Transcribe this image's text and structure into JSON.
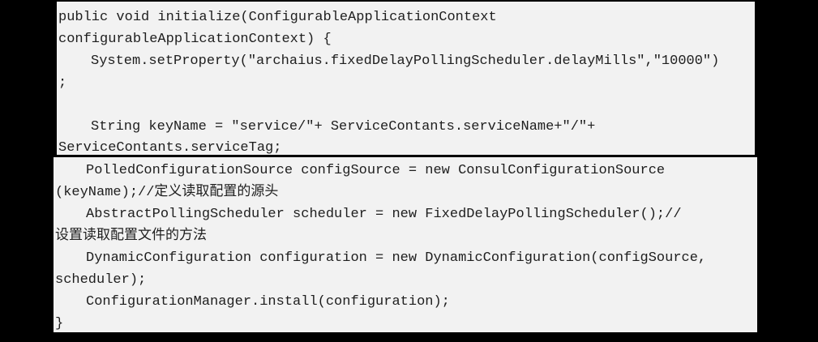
{
  "code": {
    "top_lines": [
      "public void initialize(ConfigurableApplicationContext",
      "configurableApplicationContext) {",
      "System.setProperty(\"archaius.fixedDelayPollingScheduler.delayMills\",\"10000\")",
      ";",
      "String keyName = \"service/\"+ ServiceContants.serviceName+\"/\"+",
      "ServiceContants.serviceTag;"
    ],
    "bottom_lines": [
      "PolledConfigurationSource configSource = new ConsulConfigurationSource",
      "(keyName);//定义读取配置的源头",
      "AbstractPollingScheduler scheduler = new FixedDelayPollingScheduler();//",
      "设置读取配置文件的方法",
      "DynamicConfiguration configuration = new DynamicConfiguration(configSource,",
      "scheduler);",
      "ConfigurationManager.install(configuration);",
      "}"
    ]
  }
}
